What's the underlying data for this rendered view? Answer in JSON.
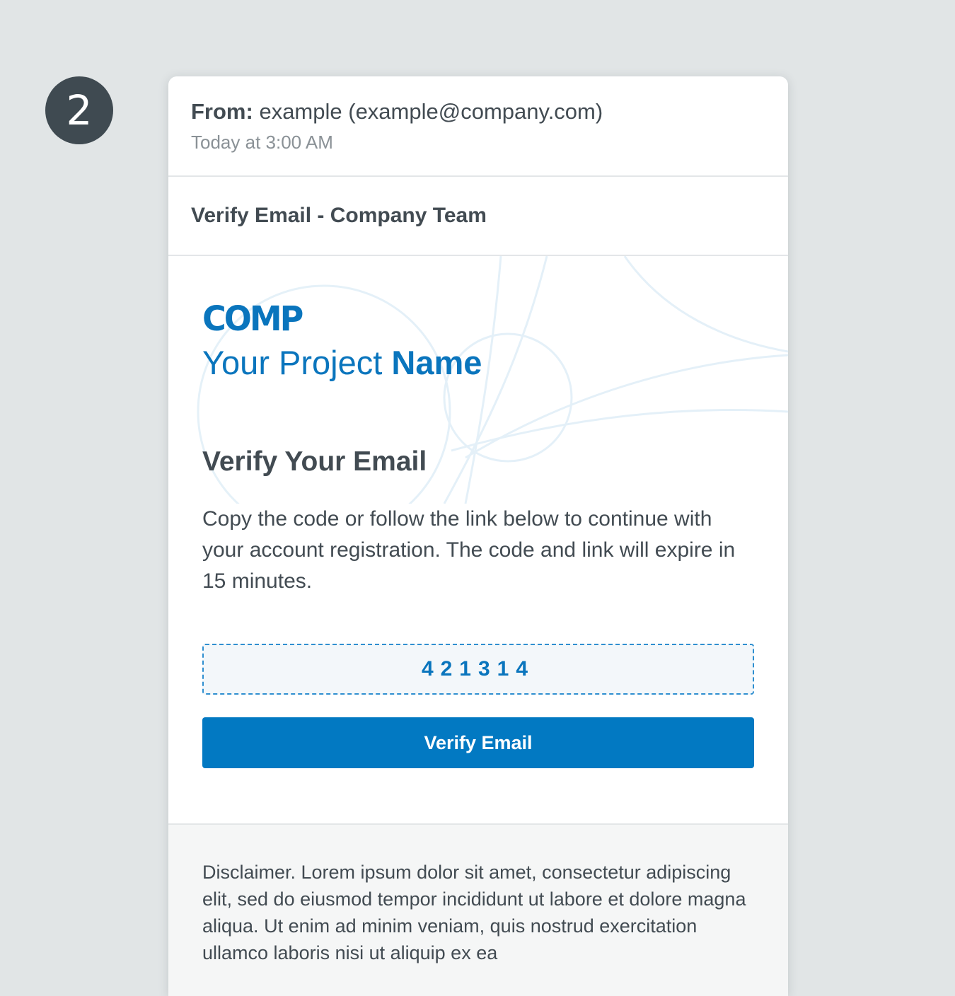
{
  "step": {
    "number": "2"
  },
  "email": {
    "from_label": "From:",
    "from_value": "example (example@company.com)",
    "timestamp": "Today at 3:00 AM",
    "subject": "Verify Email - Company Team"
  },
  "body": {
    "logo_text": "COMP",
    "project_name_light": "Your Project",
    "project_name_bold": "Name",
    "heading": "Verify Your Email",
    "instructions": "Copy the code or follow the link below to continue with your account registration. The code and link will expire in 15 minutes.",
    "code": "421314",
    "button_label": "Verify Email"
  },
  "footer": {
    "disclaimer": "Disclaimer. Lorem ipsum dolor sit amet, consectetur adipiscing elit, sed do eiusmod tempor incididunt ut labore et dolore magna aliqua. Ut enim ad minim veniam, quis nostrud exercitation ullamco laboris nisi ut aliquip ex ea"
  },
  "colors": {
    "accent": "#0279c2",
    "brand": "#0a75bd",
    "page_background": "#e1e5e6",
    "badge": "#3f4a51"
  }
}
